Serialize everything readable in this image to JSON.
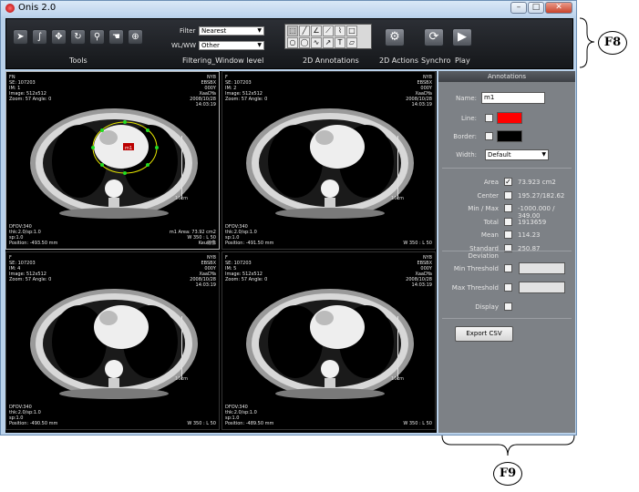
{
  "window": {
    "title": "Onis 2.0"
  },
  "toolbar": {
    "filter_label": "Filter",
    "filter_value": "Nearest",
    "wlww_label": "WL/WW",
    "wlww_value": "Other",
    "sections": {
      "tools": "Tools",
      "filtering": "Filtering_Window level",
      "annotations_2d": "2D Annotations",
      "actions_2d": "2D Actions",
      "synchro": "Synchro",
      "play": "Play"
    }
  },
  "viewports": [
    {
      "tl": "FN\nSE: 107203\nIM: 1\nImage: 512x512\nZoom: 57 Angle: 0",
      "tr": "NY8\nEBSBX\n000Y\nXaaDYa\n2008/10/28\n14:03:19",
      "bl": "DFOV:340\nthk:2.0/sp:1.0\nsp:1.0\nPosition: -493.50 mm",
      "br": "m1 Area: 73.92 cm2\nW 350 : L 50\nKeu線像",
      "scale": "10cm"
    },
    {
      "tl": "F\nSE: 107203\nIM: 2\nImage: 512x512\nZoom: 57 Angle: 0",
      "tr": "NY8\nEBSBX\n000Y\nXaaDYa\n2008/10/28\n14:03:19",
      "bl": "DFOV:340\nthk:2.0/sp:1.0\nsp:1.0\nPosition: -491.50 mm",
      "br": "W 350 : L 50",
      "scale": "10cm"
    },
    {
      "tl": "F\nSE: 107203\nIM: 4\nImage: 512x512\nZoom: 57 Angle: 0",
      "tr": "NY8\nEBSBX\n000Y\nXaaDYa\n2008/10/28\n14:03:19",
      "bl": "DFOV:340\nthk:2.0/sp:1.0\nsp:1.0\nPosition: -490.50 mm",
      "br": "W 350 : L 50",
      "scale": "10cm"
    },
    {
      "tl": "F\nSE: 107203\nIM: 5\nImage: 512x512\nZoom: 57 Angle: 0",
      "tr": "NY8\nEBSBX\n000Y\nXaaDYa\n2008/10/28\n14:03:19",
      "bl": "DFOV:340\nthk:2.0/sp:1.0\nsp:1.0\nPosition: -489.50 mm",
      "br": "W 350 : L 50",
      "scale": "10cm"
    }
  ],
  "annotation_label": "m1",
  "panel": {
    "header": "Annotations",
    "name_label": "Name:",
    "name_value": "m1",
    "line_label": "Line:",
    "line_color": "#ff0000",
    "border_label": "Border:",
    "border_color": "#000000",
    "width_label": "Width:",
    "width_value": "Default",
    "stats": [
      {
        "label": "Area",
        "value": "73.923 cm2",
        "checked": true
      },
      {
        "label": "Center",
        "value": "195.27/182.62",
        "checked": false
      },
      {
        "label": "Min / Max",
        "value": "-1000.000 / 349.00",
        "checked": false
      },
      {
        "label": "Total",
        "value": "1913659",
        "checked": false
      },
      {
        "label": "Mean",
        "value": "114.23",
        "checked": false
      },
      {
        "label": "Standard Deviation",
        "value": "250.87",
        "checked": false
      }
    ],
    "min_threshold_label": "Min Threshold",
    "max_threshold_label": "Max Threshold",
    "display_label": "Display",
    "export_label": "Export CSV"
  },
  "callouts": {
    "f8": "F8",
    "f9": "F9"
  }
}
